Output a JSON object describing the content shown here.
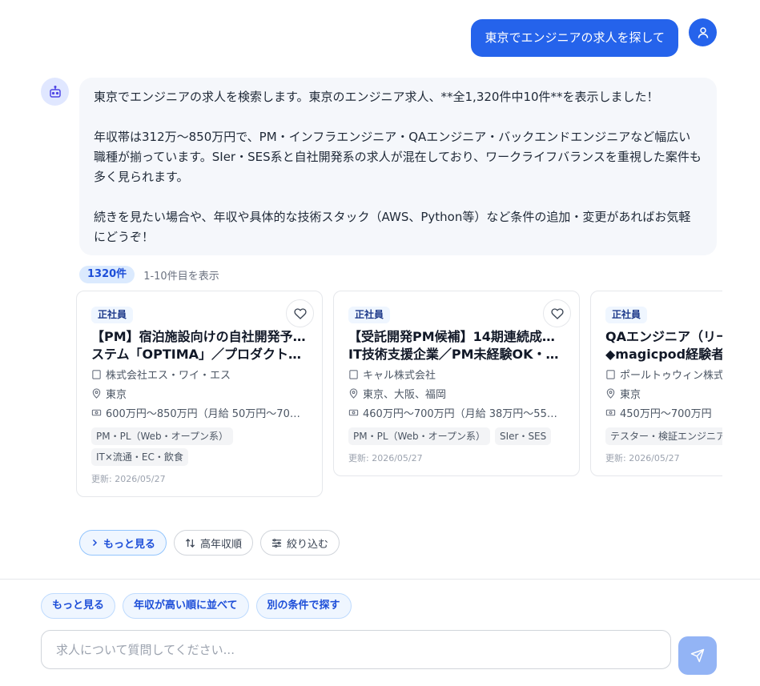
{
  "user_message": "東京でエンジニアの求人を探して",
  "bot_message": {
    "p1": "東京でエンジニアの求人を検索します。東京のエンジニア求人、**全1,320件中10件**を表示しました！",
    "p2": "年収帯は312万〜850万円で、PM・インフラエンジニア・QAエンジニア・バックエンドエンジニアなど幅広い職種が揃っています。SIer・SES系と自社開発系の求人が混在しており、ワークライフバランスを重視した案件も多く見られます。",
    "p3": "続きを見たい場合や、年収や具体的な技術スタック（AWS、Python等）など条件の追加・変更があればお気軽にどうぞ！"
  },
  "results": {
    "count_badge": "1320件",
    "range_text": "1-10件目を表示"
  },
  "cards": [
    {
      "tag": "正社員",
      "title_line1": "【PM】宿泊施設向けの自社開発予約シ",
      "title_line2": "ステム「OPTIMA」／プロダクトを…",
      "company": "株式会社エス・ワイ・エス",
      "location": "東京",
      "salary": "600万円〜850万円（月給 50万円〜70…",
      "chips": [
        "PM・PL（Web・オープン系）",
        "IT×流通・EC・飲食"
      ],
      "updated": "更新: 2026/05/27"
    },
    {
      "tag": "正社員",
      "title_line1": "【受託開発PM候補】14期連続成長の",
      "title_line2": "IT技術支援企業／PM未経験OK・残…",
      "company": "キャル株式会社",
      "location": "東京、大阪、福岡",
      "salary": "460万円〜700万円（月給 38万円〜55…",
      "chips": [
        "PM・PL（Web・オープン系）",
        "SIer・SES"
      ],
      "updated": "更新: 2026/05/27"
    },
    {
      "tag": "正社員",
      "title_line1": "QAエンジニア（リー",
      "title_line2": "◆magicpod経験者大",
      "company": "ポールトゥウィン株式",
      "location": "東京",
      "salary": "450万円〜700万円",
      "chips": [
        "テスター・検証エンジニア"
      ],
      "updated": "更新: 2026/05/27"
    }
  ],
  "actions": {
    "more": "もっと見る",
    "sort": "高年収順",
    "filter": "絞り込む"
  },
  "suggestions": [
    "もっと見る",
    "年収が高い順に並べて",
    "別の条件で探す"
  ],
  "input": {
    "placeholder": "求人について質問してください..."
  },
  "colors": {
    "accent": "#2563eb",
    "send_button": "#93b4f5",
    "bot_bubble": "#f5f7fb"
  }
}
